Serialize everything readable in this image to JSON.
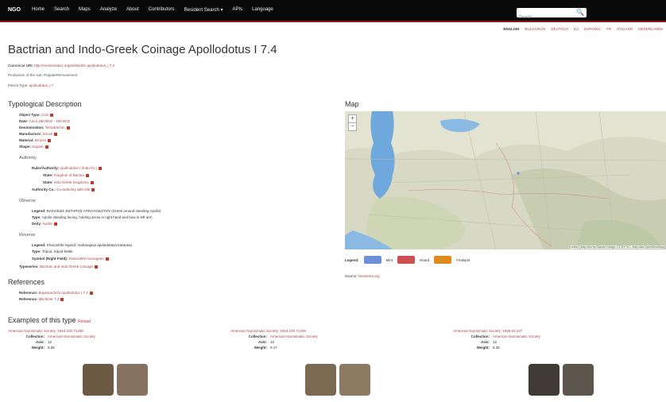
{
  "nav": {
    "brand": "NGO",
    "items": [
      "Home",
      "Search",
      "Maps",
      "Analyze",
      "About",
      "Contributors",
      "Resident Search ▾",
      "APIs",
      "Language"
    ],
    "search_placeholder": "Search",
    "search_button": "🔍"
  },
  "lang": [
    "ENGLISH",
    "BULGARIAN",
    "DEUTSCH",
    "ΕΛ",
    "ESPAÑOL",
    "FR",
    "ITALIANO",
    "NEDERLANDS"
  ],
  "page": {
    "title": "Bactrian and Indo-Greek Coinage Apollodotus I 7.4",
    "canonical_label": "Canonical URI:",
    "canonical_uri": "http://numismatics.org/pella/id/sc.apollodotus_i.7.4",
    "replaces": "Production of the sub: PrapaleRemovement",
    "parent_label": "Parent Type:",
    "parent_value": "apollodotus_i.7"
  },
  "typology": {
    "heading": "Typological Description",
    "fields": [
      {
        "label": "Object Type:",
        "value": "Coin"
      },
      {
        "label": "Date:",
        "value": "Circa 180 BCE - 160 BCE"
      },
      {
        "label": "Denomination:",
        "value": "Tetradrachm"
      },
      {
        "label": "Manufacture:",
        "value": "Struck"
      },
      {
        "label": "Material:",
        "value": "Bronze"
      },
      {
        "label": "Shape:",
        "value": "Square"
      }
    ],
    "authority_heading": "Authority",
    "authority": [
      {
        "label": "Ruler/Authority:",
        "value": "Apollodotus I (Indo-Gr.)"
      },
      {
        "label": "State:",
        "value": "Kingdom of Bactria"
      },
      {
        "label": "State:",
        "value": "Indo-Greek Kingdoms"
      },
      {
        "label": "Authority Co.:",
        "value": "Co-authority with title"
      }
    ],
    "obverse_heading": "Obverse",
    "obverse": [
      {
        "label": "Legend:",
        "value": "ΒΑΣΙΛΕΩΣ ΣΩΤΗΡΟΣ ΑΠΟΛΛΟΔΟΤΟΥ (Greek around standing Apollo)"
      },
      {
        "label": "Type:",
        "value": "Apollo standing facing, holding arrow in right hand and bow in left arm"
      },
      {
        "label": "Deity:",
        "value": "Apollo"
      }
    ],
    "reverse_heading": "Reverse",
    "reverse": [
      {
        "label": "Legend:",
        "value": "Kharoshthi legend: maharajasa apaladatasa tratarasa"
      },
      {
        "label": "Type:",
        "value": "Tripod, tripod-kettle"
      },
      {
        "label": "Symbol (Right Field):",
        "value": "Kharoshthi monogram"
      }
    ],
    "typeseries_label": "Typeseries:",
    "typeseries_value": "Bactrian and Indo-Greek Coinage"
  },
  "references": {
    "heading": "References",
    "items": [
      {
        "label": "Reference:",
        "value": "Bopearachchi Apollodotus I 7.4"
      },
      {
        "label": "Reference:",
        "value": "Mitchiner 7.4"
      }
    ]
  },
  "map": {
    "heading": "Map",
    "legend_label": "Legend:",
    "legend": [
      {
        "name": "Mint",
        "color": "#6f8fd9"
      },
      {
        "name": "Hoard",
        "color": "#cc5050"
      },
      {
        "name": "Findspot",
        "color": "#e08a1e"
      }
    ],
    "source_label": "Source:",
    "source_value": "Nomisma.org",
    "attribution": "Leaflet | Map tiles by Stamen Design, CC BY 3.0 - Map data OpenStreetMap"
  },
  "examples": {
    "heading": "Examples of this type",
    "quick_link": "Reload",
    "items": [
      {
        "title": "American Numismatic Society: 1944.100.71408",
        "collection": "American Numismatic Society",
        "axis": "12",
        "weight": "8.89",
        "colors": [
          "#6b5a44",
          "#857260"
        ]
      },
      {
        "title": "American Numismatic Society: 1944.100.71409",
        "collection": "American Numismatic Society",
        "axis": "12",
        "weight": "9.17",
        "colors": [
          "#7a6a52",
          "#8c7a62"
        ]
      },
      {
        "title": "American Numismatic Society: 1995.51.227",
        "collection": "American Numismatic Society",
        "axis": "12",
        "weight": "8.36",
        "colors": [
          "#3f3a33",
          "#5c564c"
        ]
      }
    ],
    "labels": {
      "collection": "Collection:",
      "axis": "Axis:",
      "weight": "Weight:"
    }
  }
}
